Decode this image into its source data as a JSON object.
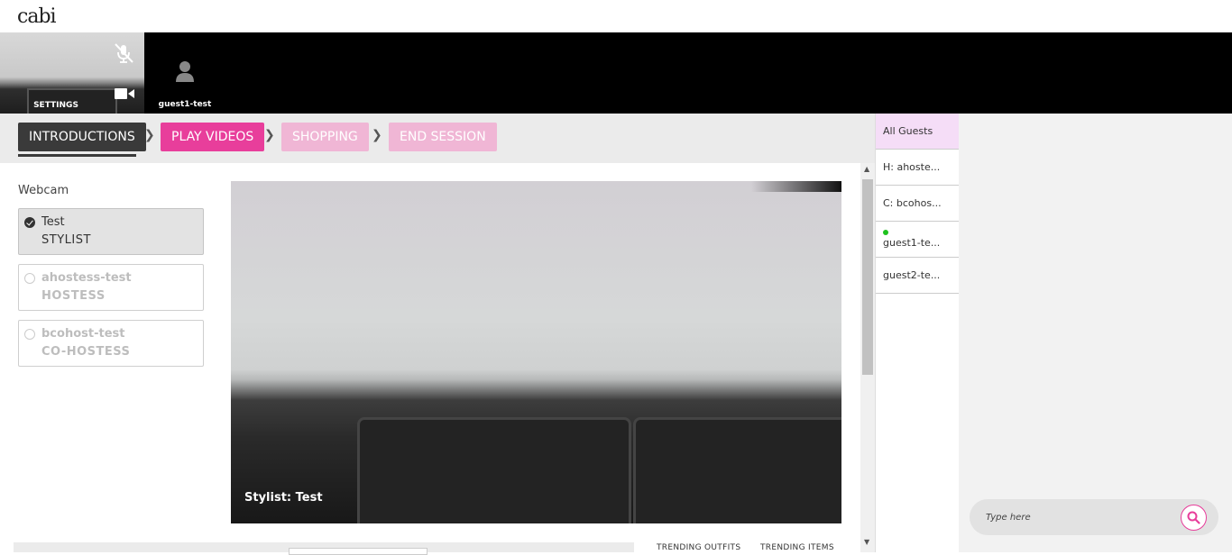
{
  "app": {
    "logo": "cabi"
  },
  "self_tile": {
    "settings_label": "SETTINGS"
  },
  "guest_tile": {
    "name": "guest1-test"
  },
  "steps": [
    {
      "label": "INTRODUCTIONS",
      "state": "current"
    },
    {
      "label": "PLAY VIDEOS",
      "state": "next"
    },
    {
      "label": "SHOPPING",
      "state": "disabled"
    },
    {
      "label": "END SESSION",
      "state": "disabled"
    }
  ],
  "webcam": {
    "label": "Webcam",
    "participants": [
      {
        "name": "Test",
        "role": "STYLIST",
        "selected": true
      },
      {
        "name": "ahostess-test",
        "role": "HOSTESS",
        "selected": false
      },
      {
        "name": "bcohost-test",
        "role": "CO-HOSTESS",
        "selected": false
      }
    ]
  },
  "main_video": {
    "caption": "Stylist: Test"
  },
  "bottom": {
    "trending_outfits": "TRENDING OUTFITS",
    "trending_items": "TRENDING ITEMS"
  },
  "guests": [
    {
      "label": "All Guests",
      "active": true
    },
    {
      "label": "H: ahoste..."
    },
    {
      "label": "C: bcohos..."
    },
    {
      "label": "guest1-te...",
      "online": true
    },
    {
      "label": "guest2-te..."
    }
  ],
  "chat": {
    "placeholder": "Type here"
  },
  "colors": {
    "accent": "#e83e9b",
    "accent_light": "#f0b6d5",
    "dark": "#3a3a3a",
    "online": "#1ec21e",
    "guest_active_bg": "#f5ddf7"
  }
}
